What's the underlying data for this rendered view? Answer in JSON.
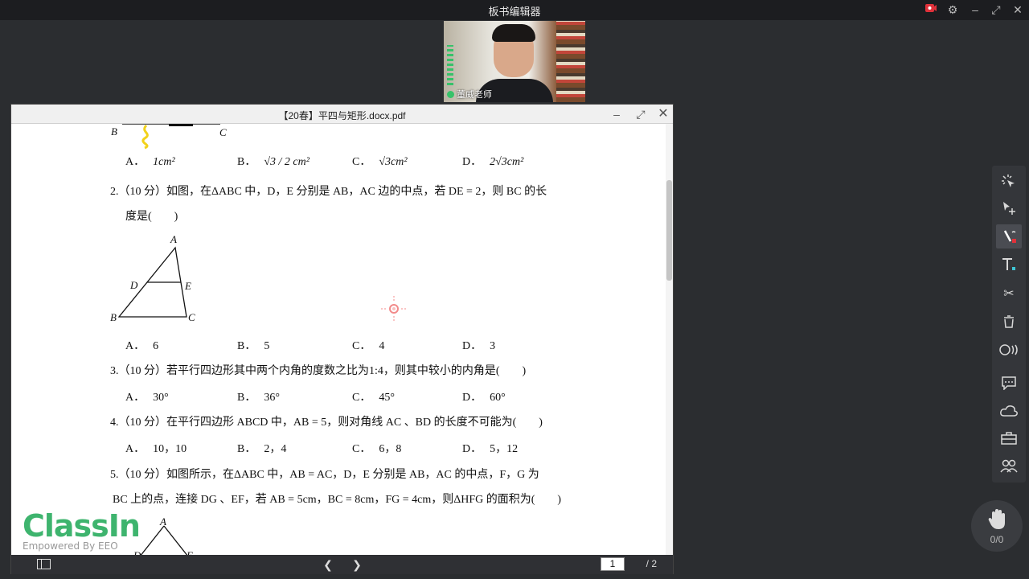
{
  "app": {
    "title": "板书编辑器"
  },
  "video": {
    "teacher_name": "董威老师"
  },
  "pdf": {
    "title": "【20春】平四与矩形.docx.pdf",
    "current_page": "1",
    "total_pages": "/ 2"
  },
  "q1": {
    "fig_b": "B",
    "fig_c": "C",
    "options": [
      {
        "label": "A．",
        "value": "1cm²"
      },
      {
        "label": "B．",
        "value": "√3 / 2 cm²"
      },
      {
        "label": "C．",
        "value": "√3cm²"
      },
      {
        "label": "D．",
        "value": "2√3cm²"
      }
    ]
  },
  "q2": {
    "line1": "2.（10 分）如图，在ΔABC 中，D，E 分别是 AB，AC 边的中点，若 DE = 2，则 BC 的长",
    "line2": "度是(　　)",
    "fig": {
      "a": "A",
      "d": "D",
      "e": "E",
      "b": "B",
      "c": "C"
    },
    "options": [
      {
        "label": "A．",
        "value": "6"
      },
      {
        "label": "B．",
        "value": "5"
      },
      {
        "label": "C．",
        "value": "4"
      },
      {
        "label": "D．",
        "value": "3"
      }
    ]
  },
  "q3": {
    "line1": "3.（10 分）若平行四边形其中两个内角的度数之比为1:4，则其中较小的内角是(　　)",
    "options": [
      {
        "label": "A．",
        "value": "30°"
      },
      {
        "label": "B．",
        "value": "36°"
      },
      {
        "label": "C．",
        "value": "45°"
      },
      {
        "label": "D．",
        "value": "60°"
      }
    ]
  },
  "q4": {
    "line1": "4.（10 分）在平行四边形 ABCD 中，AB = 5，则对角线 AC 、BD 的长度不可能为(　　)",
    "options": [
      {
        "label": "A．",
        "value": "10，10"
      },
      {
        "label": "B．",
        "value": "2，4"
      },
      {
        "label": "C．",
        "value": "6，8"
      },
      {
        "label": "D．",
        "value": "5，12"
      }
    ]
  },
  "q5": {
    "line1": "5.（10 分）如图所示，在ΔABC 中，AB = AC，D，E 分别是 AB，AC 的中点，F，G 为",
    "line2": "BC 上的点，连接 DG 、EF，若 AB = 5cm，BC = 8cm，FG = 4cm，则ΔHFG 的面积为(　　)",
    "fig": {
      "a": "A",
      "d": "D",
      "e": "E"
    }
  },
  "branding": {
    "name": "ClassIn",
    "tagline": "Empowered By EEO"
  },
  "hand_raise": {
    "count": "0/0"
  },
  "toolbar_icons": [
    "laser-pointer-icon",
    "select-move-icon",
    "pen-icon",
    "text-icon",
    "scissors-icon",
    "trash-icon",
    "more-icon",
    "chat-icon",
    "cloud-icon",
    "toolbox-icon",
    "students-icon"
  ],
  "colors": {
    "accent_green": "#3eb46e",
    "record_red": "#e0313a",
    "annotation_yellow": "#f2d21b"
  }
}
